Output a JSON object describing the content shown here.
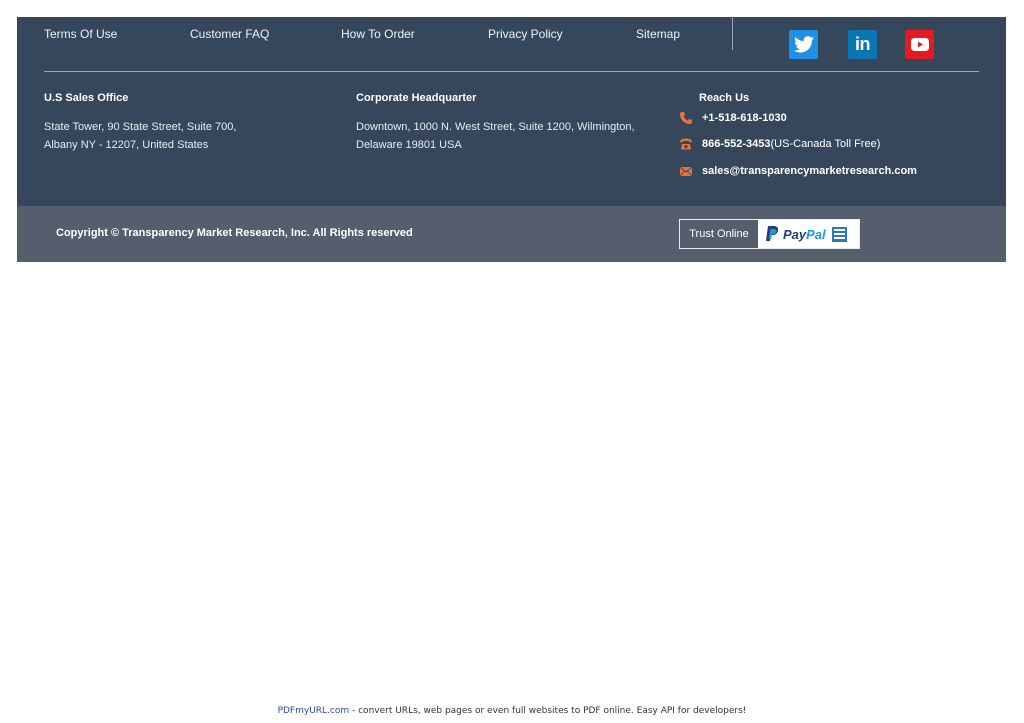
{
  "nav": {
    "links": [
      "Terms Of Use",
      "Customer FAQ",
      "How To Order",
      "Privacy Policy",
      "Sitemap"
    ]
  },
  "social": {
    "icons": [
      "twitter-icon",
      "linkedin-icon",
      "youtube-icon"
    ],
    "linkedin_glyph": "in"
  },
  "offices": {
    "us": {
      "heading": "U.S Sales Office",
      "line1": "State Tower, 90 State Street, Suite 700,",
      "line2": "Albany NY - 12207, United States"
    },
    "hq": {
      "heading": "Corporate Headquarter",
      "line1": "Downtown, 1000 N. West Street, Suite 1200, Wilmington,",
      "line2": "Delaware 19801 USA"
    }
  },
  "reach": {
    "heading": "Reach Us",
    "phone": "+1-518-618-1030",
    "tollfree_number": "866-552-3453",
    "tollfree_note": " (US-Canada Toll Free)",
    "email": "sales@transparencymarketresearch.com"
  },
  "copyright": {
    "text": "Copyright © Transparency Market Research, Inc. All Rights reserved"
  },
  "trust": {
    "label": "Trust Online",
    "paypal_pay": "Pay",
    "paypal_pal": "Pal"
  },
  "pdf_note": {
    "link": "PDFmyURL.com",
    "text": " - convert URLs, web pages or even full websites to PDF online. Easy API for developers!"
  },
  "colors": {
    "footer_bg": "#36475b",
    "copybar_bg": "#555e6c",
    "accent_orange": "#e8733a",
    "twitter": "#1f8fe6",
    "linkedin": "#0a77b5",
    "youtube": "#e21b23"
  }
}
